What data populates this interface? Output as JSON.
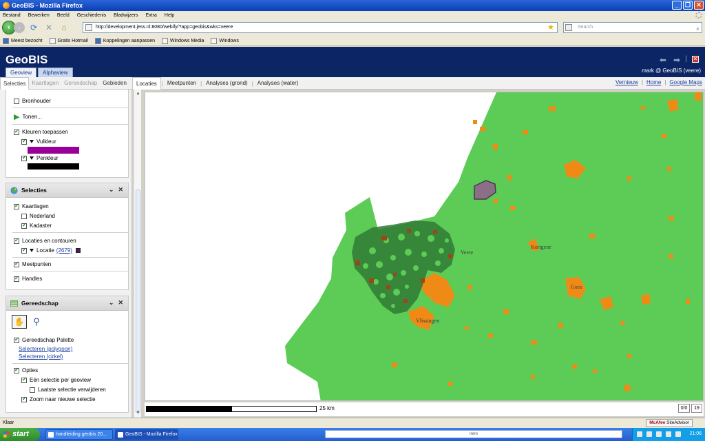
{
  "browser": {
    "window_title": "GeoBIS - Mozilla Firefox",
    "menu": [
      "Bestand",
      "Bewerken",
      "Beeld",
      "Geschiedenis",
      "Bladwijzers",
      "Extra",
      "Help"
    ],
    "url": "http://development.jess.nl:8080/webify/?app=geobis&wks=veere",
    "search_placeholder": "Search",
    "bookmarks": [
      "Meest bezocht",
      "Gratis Hotmail",
      "Koppelingen aanpassen",
      "Windows Media",
      "Windows"
    ],
    "status": "Klaar",
    "mcafee_brand": "McAfee",
    "mcafee_product": "SiteAdvisor"
  },
  "app": {
    "title": "GeoBIS",
    "view_tabs": [
      "Geoview",
      "Alphaview"
    ],
    "user": "mark @ GeoBIS (veere)",
    "left_tabs": [
      "Selecties",
      "Kaartlagen",
      "Gereedschap",
      "Gebieden"
    ],
    "right_tabs": [
      "Locaties",
      "Meetpunten",
      "Analyses (grond)",
      "Analyses (water)"
    ],
    "top_links": [
      "Vernieuw",
      "Home",
      "Google Maps"
    ]
  },
  "panel_top": {
    "bronhouder": "Bronhouder",
    "tonen": "Tonen...",
    "kleuren": "Kleuren toepassen",
    "vulkleur": "Vulkleur",
    "penkleur": "Penkleur",
    "vulkleur_color": "#990099",
    "penkleur_color": "#000000"
  },
  "selecties": {
    "title": "Selecties",
    "kaartlagen": "Kaartlagen",
    "nederland": "Nederland",
    "kadaster": "Kadaster",
    "locaties": "Locaties en contouren",
    "locatie": "Locatie",
    "locatie_count": "(2679)",
    "locatie_color": "#4a1a5a",
    "meetpunten": "Meetpunten",
    "handles": "Handles"
  },
  "gereedschap": {
    "title": "Gereedschap",
    "palette": "Gereedschap Palette",
    "sel_polygon": "Selecteren (polygoon)",
    "sel_cirkel": "Selecteren (cirkel)",
    "opties": "Opties",
    "een_selectie": "Eén selectie per geoview",
    "laatste": "Laatste selectie verwijderen",
    "zoom": "Zoom naar nieuwe selectie"
  },
  "map": {
    "places": [
      "Veere",
      "Kortgene",
      "Goes",
      "Vlissingen"
    ],
    "colors": {
      "land": "#5dcc57",
      "urban": "#f08a16",
      "parcels": "#2f7a35",
      "water": "#ffffff"
    },
    "scale_label": "25 km",
    "pager_a": "0/0",
    "pager_b": "19"
  },
  "taskbar": {
    "start": "start",
    "items": [
      "handleiding geobis 20...",
      "GeoBIS - Mozilla Firefox"
    ],
    "nero": "nero",
    "clock": "21:06"
  }
}
